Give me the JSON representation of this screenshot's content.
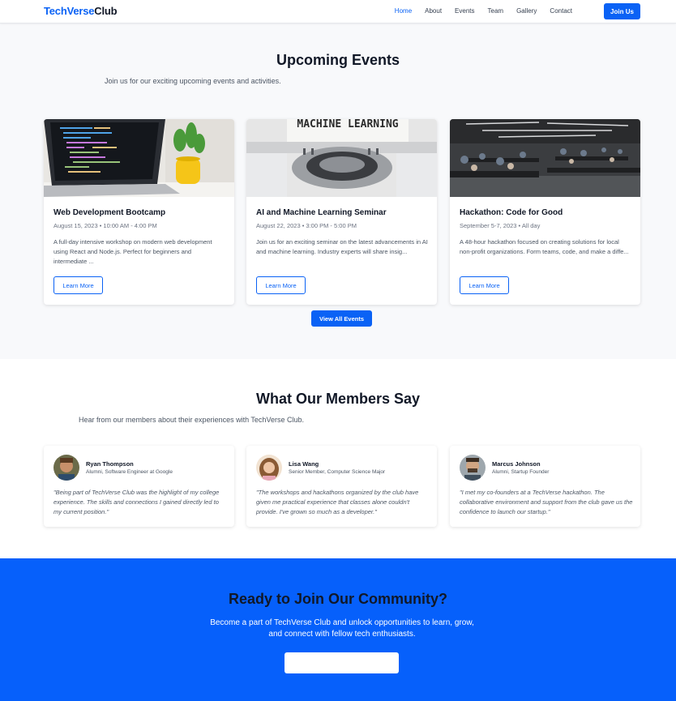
{
  "nav": {
    "brand_a": "TechVerse",
    "brand_b": "Club",
    "links": [
      "Home",
      "About",
      "Events",
      "Team",
      "Gallery",
      "Contact"
    ],
    "join_label": "Join Us"
  },
  "events": {
    "title": "Upcoming Events",
    "subtitle": "Join us for our exciting upcoming events and activities.",
    "cards": [
      {
        "title": "Web Development Bootcamp",
        "meta": "August 15, 2023 • 10:00 AM - 4:00 PM",
        "desc": "A full-day intensive workshop on modern web development using React and Node.js. Perfect for beginners and intermediate ...",
        "button": "Learn More",
        "image_icon": "laptop-code-photo"
      },
      {
        "title": "AI and Machine Learning Seminar",
        "meta": "August 22, 2023 • 3:00 PM - 5:00 PM",
        "desc": "Join us for an exciting seminar on the latest advancements in AI and machine learning. Industry experts will share insig...",
        "button": "Learn More",
        "image_icon": "typewriter-photo",
        "image_text": "MACHINE LEARNING"
      },
      {
        "title": "Hackathon: Code for Good",
        "meta": "September 5-7, 2023 • All day",
        "desc": "A 48-hour hackathon focused on creating solutions for local non-profit organizations. Form teams, code, and make a diffe...",
        "button": "Learn More",
        "image_icon": "hackathon-room-photo"
      }
    ],
    "view_all": "View All Events"
  },
  "testimonials": {
    "title": "What Our Members Say",
    "subtitle": "Hear from our members about their experiences with TechVerse Club.",
    "items": [
      {
        "name": "Ryan Thompson",
        "role": "Alumni, Software Engineer at Google",
        "quote": "\"Being part of TechVerse Club was the highlight of my college experience. The skills and connections I gained directly led to my current position.\""
      },
      {
        "name": "Lisa Wang",
        "role": "Senior Member, Computer Science Major",
        "quote": "\"The workshops and hackathons organized by the club have given me practical experience that classes alone couldn't provide. I've grown so much as a developer.\""
      },
      {
        "name": "Marcus Johnson",
        "role": "Alumni, Startup Founder",
        "quote": "\"I met my co-founders at a TechVerse hackathon. The collaborative environment and support from the club gave us the confidence to launch our startup.\""
      }
    ]
  },
  "cta": {
    "title": "Ready to Join Our Community?",
    "text": "Become a part of TechVerse Club and unlock opportunities to learn, grow, and connect with fellow tech enthusiasts.",
    "button": ""
  },
  "colors": {
    "accent": "#0a62f5",
    "cta_bg": "#0660fb",
    "events_bg": "#f8f9fb"
  }
}
